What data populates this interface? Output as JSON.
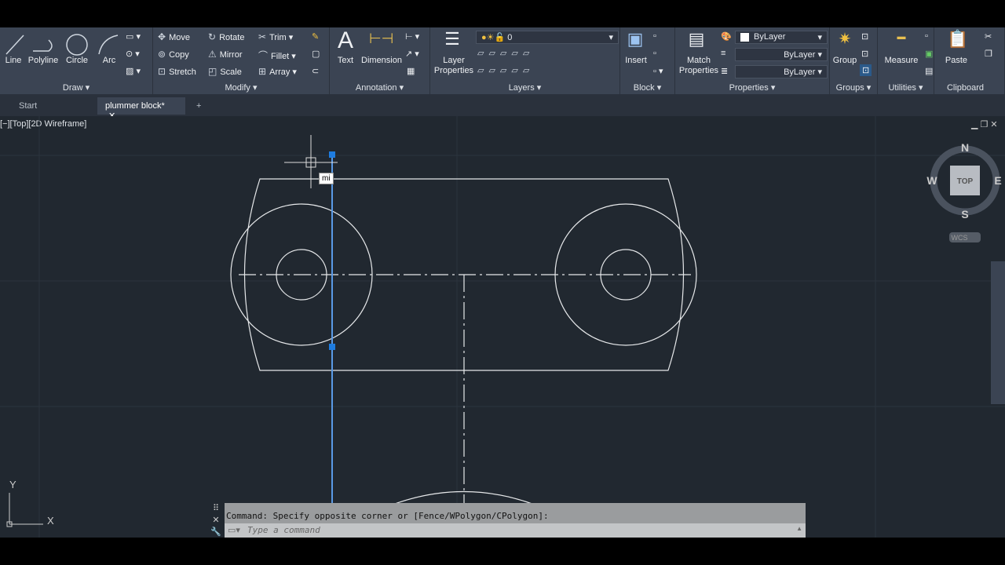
{
  "ribbon": {
    "draw": {
      "label": "Draw",
      "line": "Line",
      "polyline": "Polyline",
      "circle": "Circle",
      "arc": "Arc"
    },
    "modify": {
      "label": "Modify",
      "move": "Move",
      "rotate": "Rotate",
      "trim": "Trim",
      "copy": "Copy",
      "mirror": "Mirror",
      "fillet": "Fillet",
      "stretch": "Stretch",
      "scale": "Scale",
      "array": "Array"
    },
    "annotation": {
      "label": "Annotation",
      "text": "Text",
      "dimension": "Dimension"
    },
    "layers": {
      "label": "Layers",
      "layer_properties": "Layer Properties",
      "current_layer": "0"
    },
    "block": {
      "label": "Block",
      "insert": "Insert"
    },
    "properties": {
      "label": "Properties",
      "match": "Match Properties",
      "color": "ByLayer",
      "linetype": "ByLayer",
      "lineweight": "ByLayer"
    },
    "groups": {
      "label": "Groups",
      "group": "Group"
    },
    "utilities": {
      "label": "Utilities",
      "measure": "Measure"
    },
    "clipboard": {
      "label": "Clipboard",
      "paste": "Paste"
    }
  },
  "tabs": {
    "start": "Start",
    "doc": "plummer block*",
    "add": "+"
  },
  "viewport": {
    "label": "[−][Top][2D Wireframe]",
    "cursor_input": "mi"
  },
  "viewcube": {
    "n": "N",
    "s": "S",
    "e": "E",
    "w": "W",
    "face": "TOP",
    "wcs": "WCS"
  },
  "ucs": {
    "x": "X",
    "y": "Y"
  },
  "command": {
    "history": "Command: Specify opposite corner or [Fence/WPolygon/CPolygon]:",
    "placeholder": "Type a command"
  },
  "colors": {
    "canvas": "#212830",
    "ribbon": "#3b4453",
    "grip": "#1e7ce0"
  }
}
